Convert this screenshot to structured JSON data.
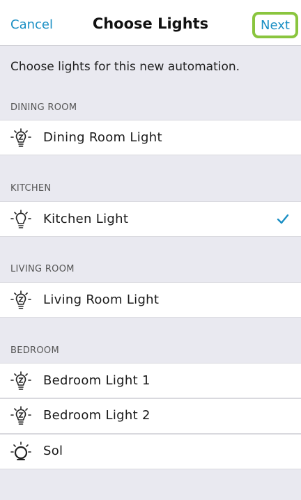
{
  "nav": {
    "cancel_label": "Cancel",
    "title": "Choose Lights",
    "next_label": "Next"
  },
  "intro_text": "Choose lights for this new automation.",
  "sections": [
    {
      "header": "DINING ROOM",
      "rows": [
        {
          "label": "Dining Room Light",
          "icon": "bulb-z-icon",
          "selected": false
        }
      ]
    },
    {
      "header": "KITCHEN",
      "rows": [
        {
          "label": "Kitchen Light",
          "icon": "bulb-icon",
          "selected": true
        }
      ]
    },
    {
      "header": "LIVING ROOM",
      "rows": [
        {
          "label": "Living Room Light",
          "icon": "bulb-z-icon",
          "selected": false
        }
      ]
    },
    {
      "header": "BEDROOM",
      "rows": [
        {
          "label": "Bedroom Light 1",
          "icon": "bulb-z-icon",
          "selected": false
        },
        {
          "label": "Bedroom Light 2",
          "icon": "bulb-z-icon",
          "selected": false
        },
        {
          "label": "Sol",
          "icon": "round-lamp-icon",
          "selected": false
        }
      ]
    }
  ],
  "colors": {
    "accent": "#1a8fc4",
    "highlight": "#8ac53e",
    "background": "#e9e9f0"
  }
}
